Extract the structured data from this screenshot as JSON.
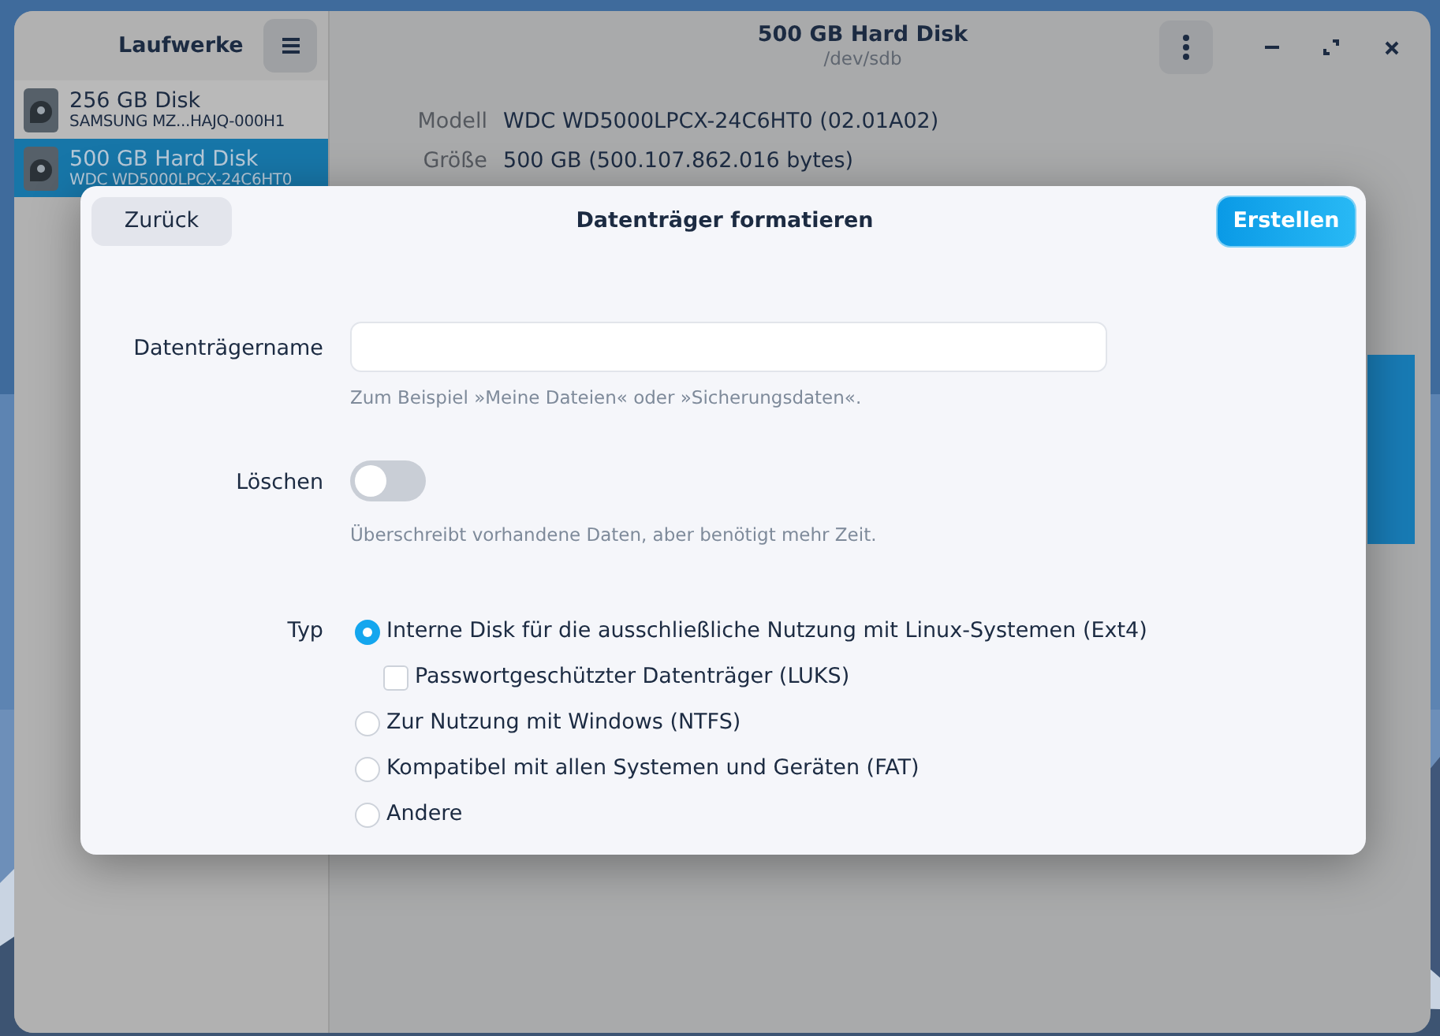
{
  "window": {
    "title": "500 GB Hard Disk",
    "subtitle": "/dev/sdb"
  },
  "sidebar": {
    "title": "Laufwerke",
    "items": [
      {
        "name": "256 GB Disk",
        "detail": "SAMSUNG MZ...HAJQ-000H1",
        "selected": false
      },
      {
        "name": "500 GB Hard Disk",
        "detail": "WDC WD5000LPCX-24C6HT0",
        "selected": true
      }
    ]
  },
  "details": [
    {
      "label": "Modell",
      "value": "WDC WD5000LPCX-24C6HT0 (02.01A02)"
    },
    {
      "label": "Größe",
      "value": "500 GB (500.107.862.016 bytes)"
    }
  ],
  "dialog": {
    "title": "Datenträger formatieren",
    "back_button": "Zurück",
    "create_button": "Erstellen",
    "name_field": {
      "label": "Datenträgername",
      "hint": "Zum Beispiel »Meine Dateien« oder »Sicherungsdaten«."
    },
    "erase": {
      "label": "Löschen",
      "on": false,
      "hint": "Überschreibt vorhandene Daten, aber benötigt mehr Zeit."
    },
    "type": {
      "label": "Typ",
      "options": [
        {
          "kind": "radio",
          "label": "Interne Disk für die ausschließliche Nutzung mit Linux-Systemen (Ext4)",
          "selected": true
        },
        {
          "kind": "checkbox",
          "label": "Passwortgeschützter Datenträger (LUKS)",
          "checked": false
        },
        {
          "kind": "radio",
          "label": "Zur Nutzung mit Windows (NTFS)",
          "selected": false
        },
        {
          "kind": "radio",
          "label": "Kompatibel mit allen Systemen und Geräten (FAT)",
          "selected": false
        },
        {
          "kind": "radio",
          "label": "Andere",
          "selected": false
        }
      ]
    }
  }
}
